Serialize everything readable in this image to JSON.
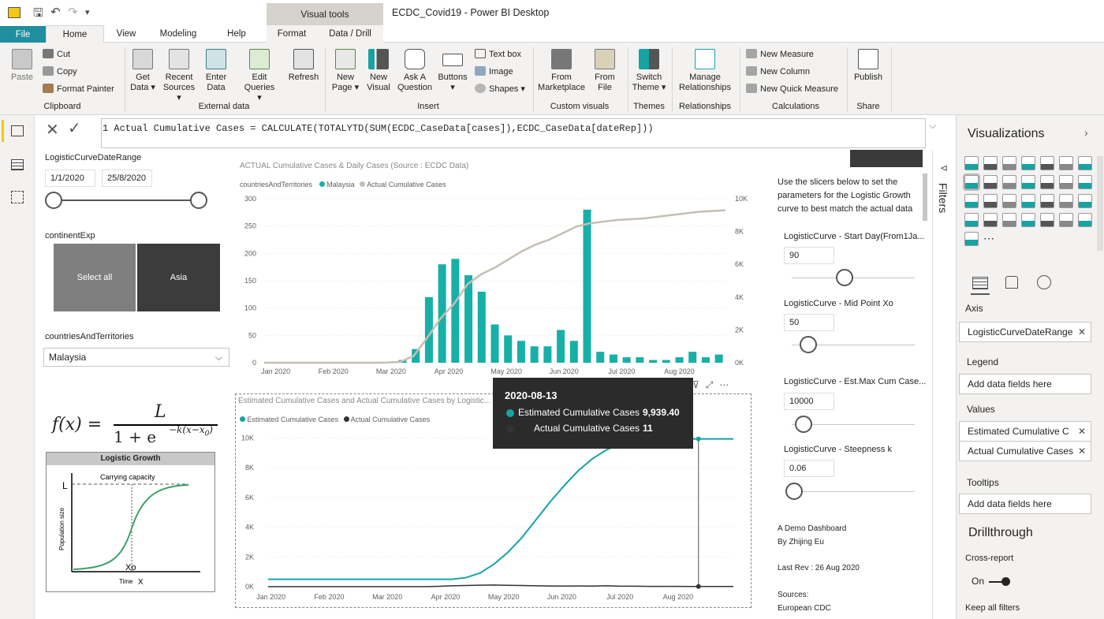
{
  "app": {
    "title": "ECDC_Covid19 - Power BI Desktop",
    "visual_tools": "Visual tools"
  },
  "tabs": [
    "File",
    "Home",
    "View",
    "Modeling",
    "Help",
    "Format",
    "Data / Drill"
  ],
  "ribbon": {
    "clipboard": {
      "paste": "Paste",
      "cut": "Cut",
      "copy": "Copy",
      "format_painter": "Format Painter",
      "group": "Clipboard"
    },
    "external": {
      "get_data": "Get Data ▾",
      "recent_sources": "Recent Sources ▾",
      "enter_data": "Enter Data",
      "edit_queries": "Edit Queries ▾",
      "refresh": "Refresh",
      "group": "External data"
    },
    "insert": {
      "new_page": "New Page ▾",
      "new_visual": "New Visual",
      "ask_question": "Ask A Question",
      "buttons": "Buttons ▾",
      "text_box": "Text box",
      "image": "Image",
      "shapes": "Shapes ▾",
      "group": "Insert"
    },
    "custom": {
      "from_marketplace": "From Marketplace",
      "from_file": "From File",
      "group": "Custom visuals"
    },
    "themes": {
      "switch_theme": "Switch Theme ▾",
      "group": "Themes"
    },
    "relationships": {
      "manage": "Manage Relationships",
      "group": "Relationships"
    },
    "calculations": {
      "new_measure": "New Measure",
      "new_column": "New Column",
      "new_quick_measure": "New Quick Measure",
      "group": "Calculations"
    },
    "share": {
      "publish": "Publish",
      "group": "Share"
    }
  },
  "formula": "1  Actual Cumulative Cases = CALCULATE(TOTALYTD(SUM(ECDC_CaseData[cases]),ECDC_CaseData[dateRep]))",
  "slicers": {
    "date_range_title": "LogisticCurveDateRange",
    "date_from": "1/1/2020",
    "date_to": "25/8/2020",
    "continent_title": "continentExp",
    "select_all": "Select all",
    "asia": "Asia",
    "countries_title": "countriesAndTerritories",
    "country_value": "Malaysia"
  },
  "right_panel": {
    "intro": "Use the slicers below to set the parameters for the Logistic Growth curve to best match the actual data",
    "start_day_label": "LogisticCurve - Start Day(From1Ja...",
    "start_day_value": "90",
    "midpoint_label": "LogisticCurve - Mid Point Xo",
    "midpoint_value": "50",
    "maxcum_label": "LogisticCurve - Est.Max Cum Case...",
    "maxcum_value": "10000",
    "steepness_label": "LogisticCurve - Steepness k",
    "steepness_value": "0.06",
    "demo1": "A Demo Dashboard",
    "demo2": "By Zhijing Eu",
    "lastrev": "Last Rev : 26 Aug 2020",
    "sources": "Sources:",
    "source1": "European CDC"
  },
  "formula_image": {
    "equation_lhs": "f(x) =",
    "numerator": "L",
    "denominator": "1 + e",
    "exponent": "−k(x−x",
    "exponent_sub": "0",
    "exponent_close": ")",
    "diagram_title": "Logistic Growth",
    "carrying": "Carrying capacity",
    "L": "L",
    "xo": "Xo",
    "yaxis": "Population size",
    "xaxis": "Time",
    "xaxis_var": "X"
  },
  "chart_data": [
    {
      "type": "bar",
      "title": "ACTUAL Cumulative Cases & Daily Cases (Source : ECDC Data)",
      "legend_title": "countriesAndTerritories",
      "series": [
        {
          "name": "Malaysia",
          "kind": "bar",
          "axis": "left",
          "color": "#17b0a8"
        },
        {
          "name": "Actual Cumulative Cases",
          "kind": "line",
          "axis": "right",
          "color": "#c5bfb4"
        }
      ],
      "x_ticks": [
        "Jan 2020",
        "Feb 2020",
        "Mar 2020",
        "Apr 2020",
        "May 2020",
        "Jun 2020",
        "Jul 2020",
        "Aug 2020"
      ],
      "y_left_ticks": [
        "0",
        "50",
        "100",
        "150",
        "200",
        "250",
        "300"
      ],
      "y_left_range": [
        0,
        300
      ],
      "y_right_ticks": [
        "0K",
        "2K",
        "4K",
        "6K",
        "8K",
        "10K"
      ],
      "y_right_range": [
        0,
        10000
      ],
      "daily_cases_weekly_sample": [
        0,
        0,
        0,
        0,
        0,
        0,
        0,
        0,
        0,
        0,
        5,
        25,
        120,
        180,
        190,
        160,
        130,
        70,
        50,
        40,
        30,
        30,
        60,
        40,
        280,
        20,
        15,
        10,
        10,
        5,
        5,
        10,
        20,
        10,
        15
      ],
      "cumulative_weekly_sample": [
        0,
        0,
        0,
        0,
        0,
        0,
        0,
        0,
        0,
        10,
        50,
        400,
        1500,
        2700,
        3600,
        4800,
        5400,
        5800,
        6300,
        6800,
        7200,
        7500,
        7900,
        8300,
        8500,
        8600,
        8700,
        8750,
        8800,
        8900,
        9000,
        9100,
        9200,
        9250,
        9300
      ]
    },
    {
      "type": "line",
      "title": "Estimated Cumulative Cases and Actual Cumulative Cases by Logistic...",
      "series": [
        {
          "name": "Estimated Cumulative Cases",
          "color": "#17a3a3"
        },
        {
          "name": "Actual Cumulative Cases",
          "color": "#333333"
        }
      ],
      "x_ticks": [
        "Jan 2020",
        "Feb 2020",
        "Mar 2020",
        "Apr 2020",
        "May 2020",
        "Jun 2020",
        "Jul 2020",
        "Aug 2020"
      ],
      "y_ticks": [
        "0K",
        "2K",
        "4K",
        "6K",
        "8K",
        "10K"
      ],
      "y_range": [
        0,
        10500
      ],
      "estimated_weekly_sample": [
        500,
        500,
        500,
        500,
        500,
        500,
        500,
        500,
        500,
        500,
        500,
        500,
        500,
        500,
        600,
        900,
        1500,
        2300,
        3300,
        4500,
        5700,
        6800,
        7800,
        8600,
        9200,
        9600,
        9800,
        9900,
        9940,
        9940,
        9940,
        9940,
        9940,
        9940
      ],
      "actual_weekly_sample": [
        0,
        0,
        0,
        0,
        0,
        0,
        0,
        0,
        0,
        0,
        0,
        0,
        20,
        60,
        80,
        100,
        110,
        90,
        80,
        60,
        50,
        40,
        50,
        40,
        60,
        30,
        30,
        20,
        20,
        20,
        15,
        15,
        11,
        11
      ]
    }
  ],
  "tooltip": {
    "date": "2020-08-13",
    "row1_label": "Estimated Cumulative Cases",
    "row1_value": "9,939.40",
    "row2_label": "Actual Cumulative Cases",
    "row2_value": "11"
  },
  "viz_pane": {
    "title": "Visualizations",
    "filters": "Filters",
    "axis": "Axis",
    "axis_field": "LogisticCurveDateRange",
    "legend": "Legend",
    "add_fields": "Add data fields here",
    "values": "Values",
    "value1": "Estimated Cumulative C",
    "value2": "Actual Cumulative Cases",
    "tooltips": "Tooltips",
    "drillthrough": "Drillthrough",
    "cross_report": "Cross-report",
    "on": "On",
    "keep_all": "Keep all filters"
  }
}
